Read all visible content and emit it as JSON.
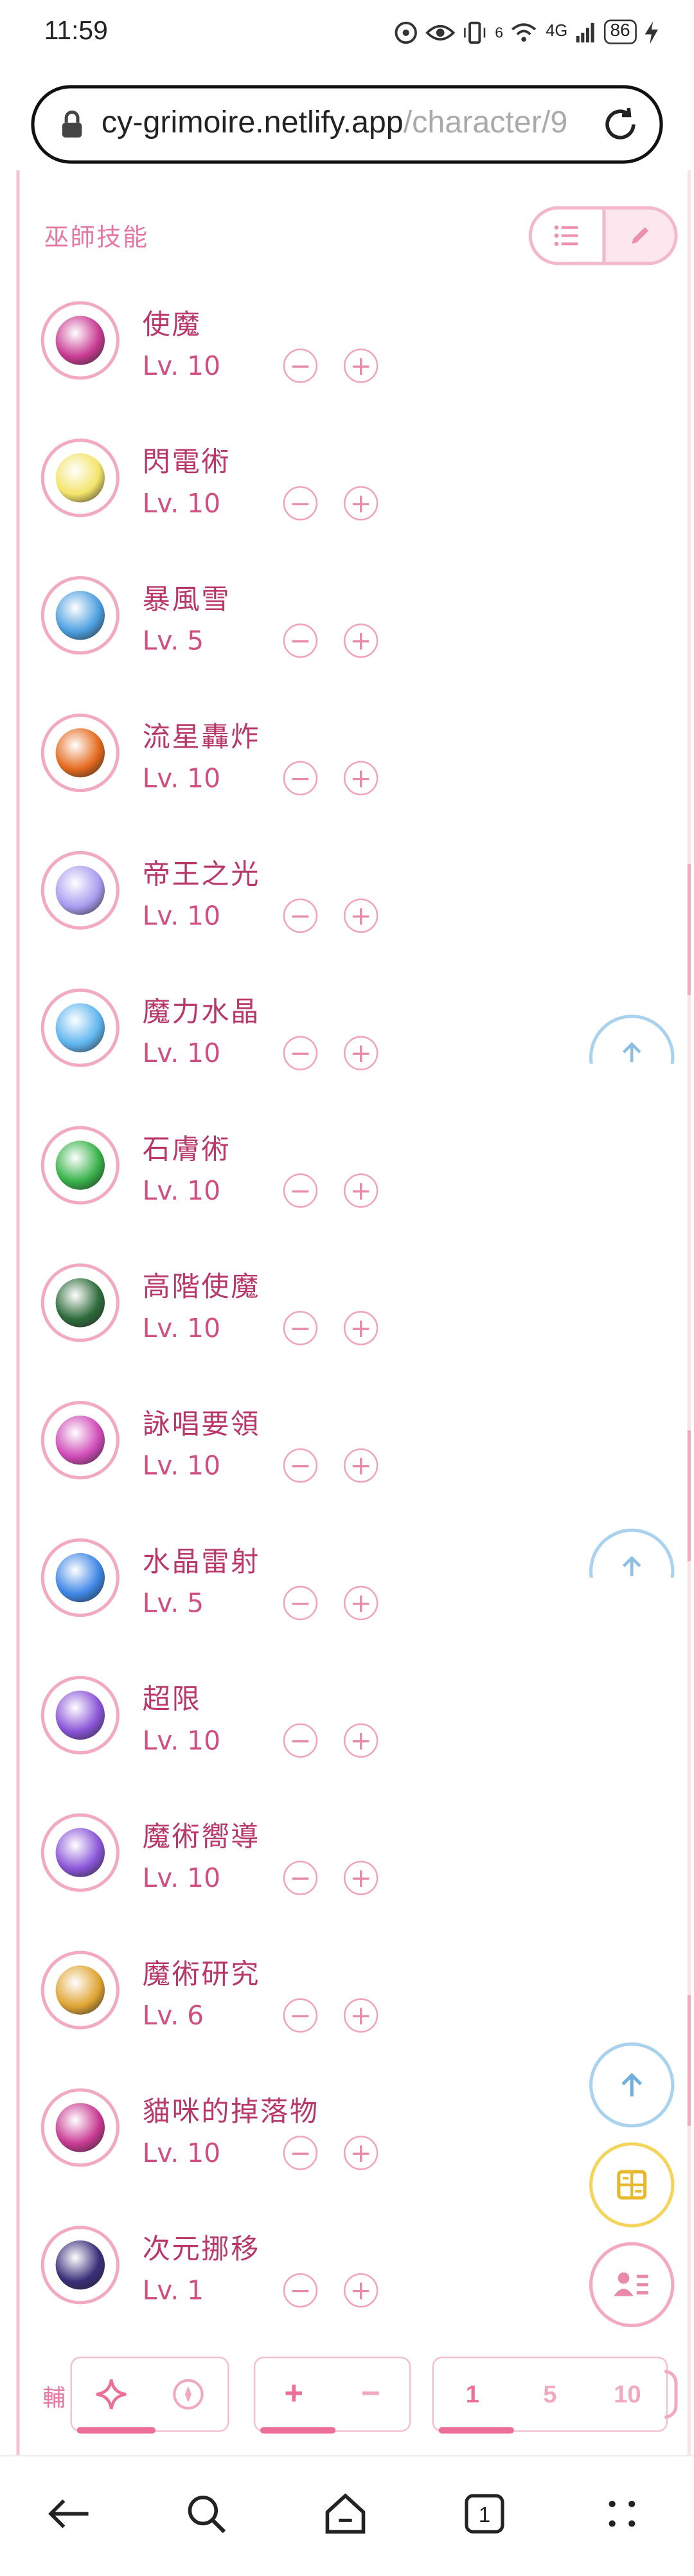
{
  "status_bar": {
    "time": "11:59",
    "signal": "4G",
    "wifi_label": "6",
    "battery": "86"
  },
  "browser": {
    "url_host": "cy-grimoire.netlify.app",
    "url_path": "/character/9",
    "tab_count": "1"
  },
  "section": {
    "title": "巫師技能",
    "view_toggle": [
      "list-icon",
      "pencil-icon"
    ]
  },
  "skills": [
    {
      "name": "使魔",
      "level_label": "Lv. 10",
      "level": 10,
      "color": "#c93b93"
    },
    {
      "name": "閃電術",
      "level_label": "Lv. 10",
      "level": 10,
      "color": "#f3e46a"
    },
    {
      "name": "暴風雪",
      "level_label": "Lv. 5",
      "level": 5,
      "color": "#4d9fe0"
    },
    {
      "name": "流星轟炸",
      "level_label": "Lv. 10",
      "level": 10,
      "color": "#e56a1e"
    },
    {
      "name": "帝王之光",
      "level_label": "Lv. 10",
      "level": 10,
      "color": "#a99df0"
    },
    {
      "name": "魔力水晶",
      "level_label": "Lv. 10",
      "level": 10,
      "color": "#5fb6ef"
    },
    {
      "name": "石膚術",
      "level_label": "Lv. 10",
      "level": 10,
      "color": "#38b24a"
    },
    {
      "name": "高階使魔",
      "level_label": "Lv. 10",
      "level": 10,
      "color": "#2f6c3c"
    },
    {
      "name": "詠唱要領",
      "level_label": "Lv. 10",
      "level": 10,
      "color": "#d04bb8"
    },
    {
      "name": "水晶雷射",
      "level_label": "Lv. 5",
      "level": 5,
      "color": "#3f86e6"
    },
    {
      "name": "超限",
      "level_label": "Lv. 10",
      "level": 10,
      "color": "#8a55d8"
    },
    {
      "name": "魔術嚮導",
      "level_label": "Lv. 10",
      "level": 10,
      "color": "#8a55d8"
    },
    {
      "name": "魔術研究",
      "level_label": "Lv. 6",
      "level": 6,
      "color": "#e0a534"
    },
    {
      "name": "貓咪的掉落物",
      "level_label": "Lv. 10",
      "level": 10,
      "color": "#c93b93"
    },
    {
      "name": "次元挪移",
      "level_label": "Lv. 1",
      "level": 1,
      "color": "#3a2f7a"
    }
  ],
  "controls": {
    "minus_symbol": "−",
    "plus_symbol": "+"
  },
  "bottom_bar": {
    "label": "輔",
    "mode_icons": [
      "sparkle-icon",
      "compass-icon"
    ],
    "sign_group": [
      "+",
      "−"
    ],
    "step_group": [
      "1",
      "5",
      "10"
    ]
  },
  "colors": {
    "accent_pink": "#ec6f98",
    "text_pink": "#b8386a",
    "fab_blue": "#a9d2ee",
    "fab_yellow": "#f4d45a"
  }
}
